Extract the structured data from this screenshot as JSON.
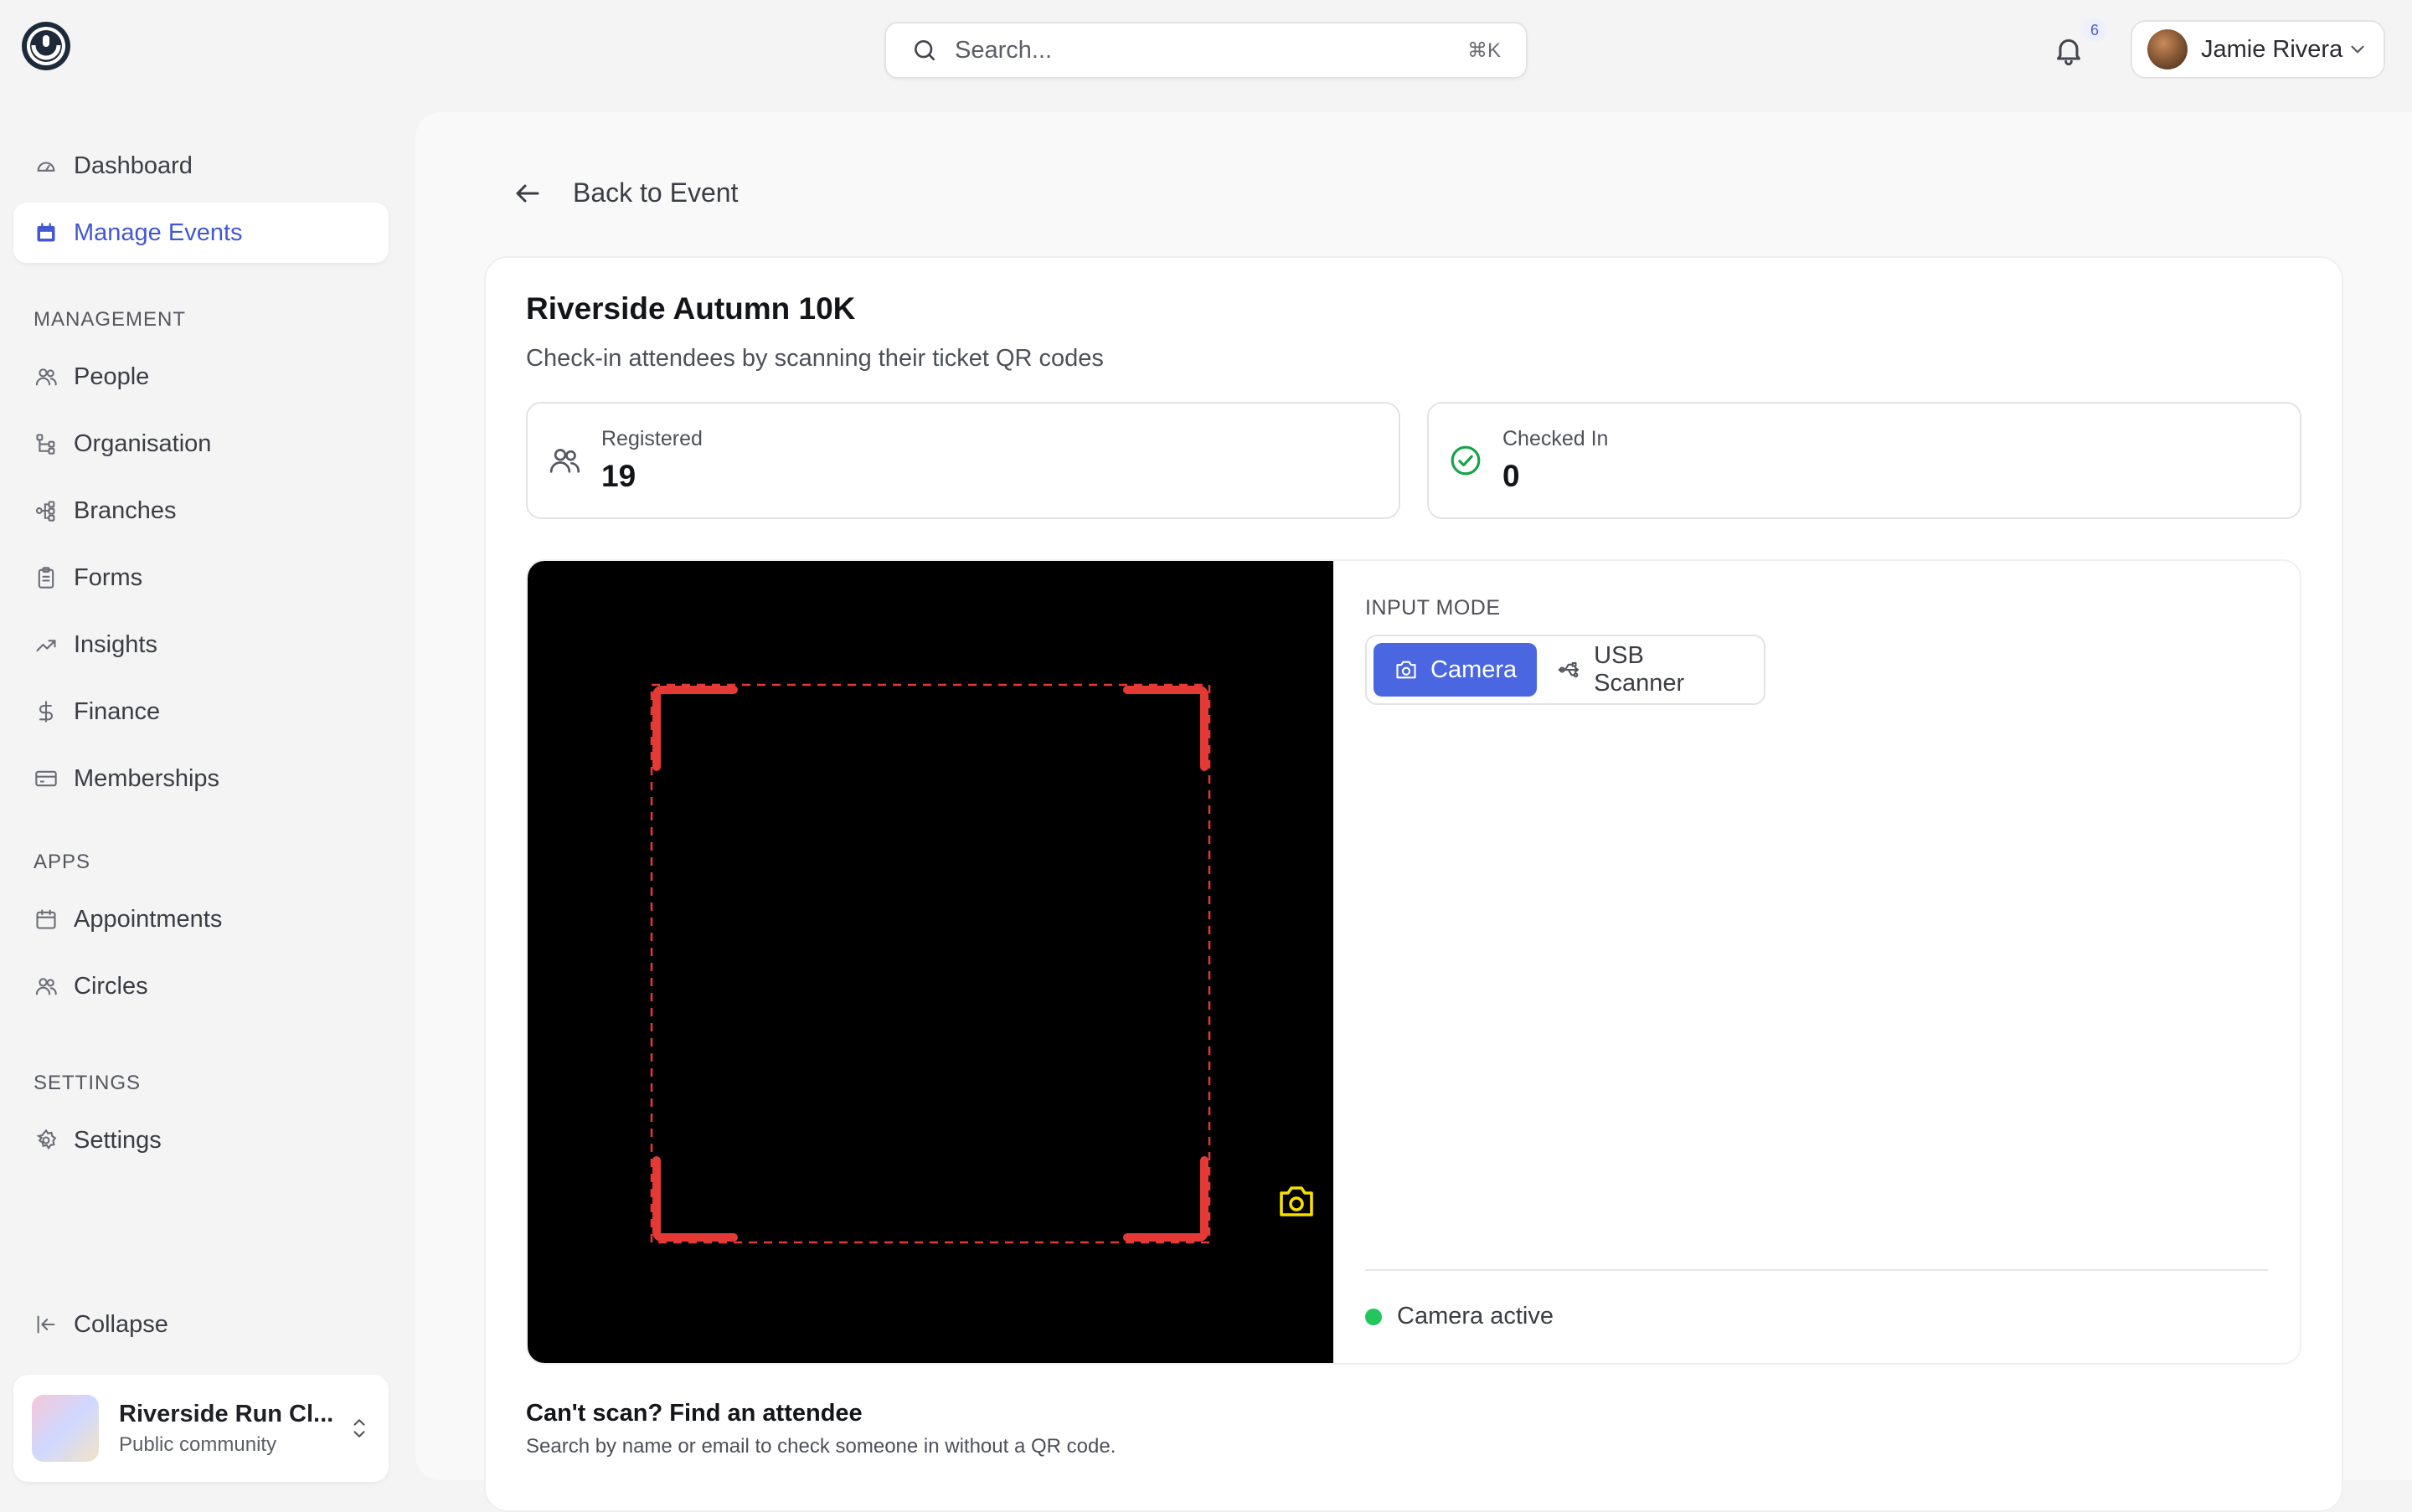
{
  "search": {
    "placeholder": "Search...",
    "shortcut": "⌘K"
  },
  "notifications": {
    "count": "6"
  },
  "user": {
    "name": "Jamie Rivera"
  },
  "sidebar": {
    "top_items": [
      {
        "label": "Dashboard",
        "icon": "gauge-icon"
      },
      {
        "label": "Manage Events",
        "icon": "calendar-icon",
        "active": true
      }
    ],
    "management": {
      "label": "MANAGEMENT",
      "items": [
        {
          "label": "People",
          "icon": "users-icon"
        },
        {
          "label": "Organisation",
          "icon": "hierarchy-icon"
        },
        {
          "label": "Branches",
          "icon": "branches-icon"
        },
        {
          "label": "Forms",
          "icon": "clipboard-icon"
        },
        {
          "label": "Insights",
          "icon": "trend-up-icon"
        },
        {
          "label": "Finance",
          "icon": "dollar-icon"
        },
        {
          "label": "Memberships",
          "icon": "card-icon"
        }
      ]
    },
    "apps": {
      "label": "APPS",
      "items": [
        {
          "label": "Appointments",
          "icon": "calendar-icon"
        },
        {
          "label": "Circles",
          "icon": "users-icon"
        }
      ]
    },
    "settings": {
      "label": "SETTINGS",
      "items": [
        {
          "label": "Settings",
          "icon": "gear-icon"
        }
      ]
    },
    "collapse_label": "Collapse",
    "org": {
      "name": "Riverside Run Cl...",
      "subtitle": "Public community"
    }
  },
  "main": {
    "back_label": "Back to Event",
    "event_title": "Riverside Autumn 10K",
    "event_subtitle": "Check-in attendees by scanning their ticket QR codes",
    "stats": [
      {
        "label": "Registered",
        "value": "19"
      },
      {
        "label": "Checked In",
        "value": "0"
      }
    ],
    "scanner": {
      "input_mode_label": "INPUT MODE",
      "modes": [
        {
          "label": "Camera",
          "active": true
        },
        {
          "label": "USB Scanner",
          "active": false
        }
      ],
      "status": "Camera active"
    },
    "find": {
      "title": "Can't scan? Find an attendee",
      "subtitle": "Search by name or email to check someone in without a QR code."
    }
  },
  "colors": {
    "accent": "#4457cf",
    "mode_active": "#4a66e0",
    "scan_frame": "#e53935",
    "status_active": "#22c55e",
    "camera_switch": "#f5e000"
  }
}
